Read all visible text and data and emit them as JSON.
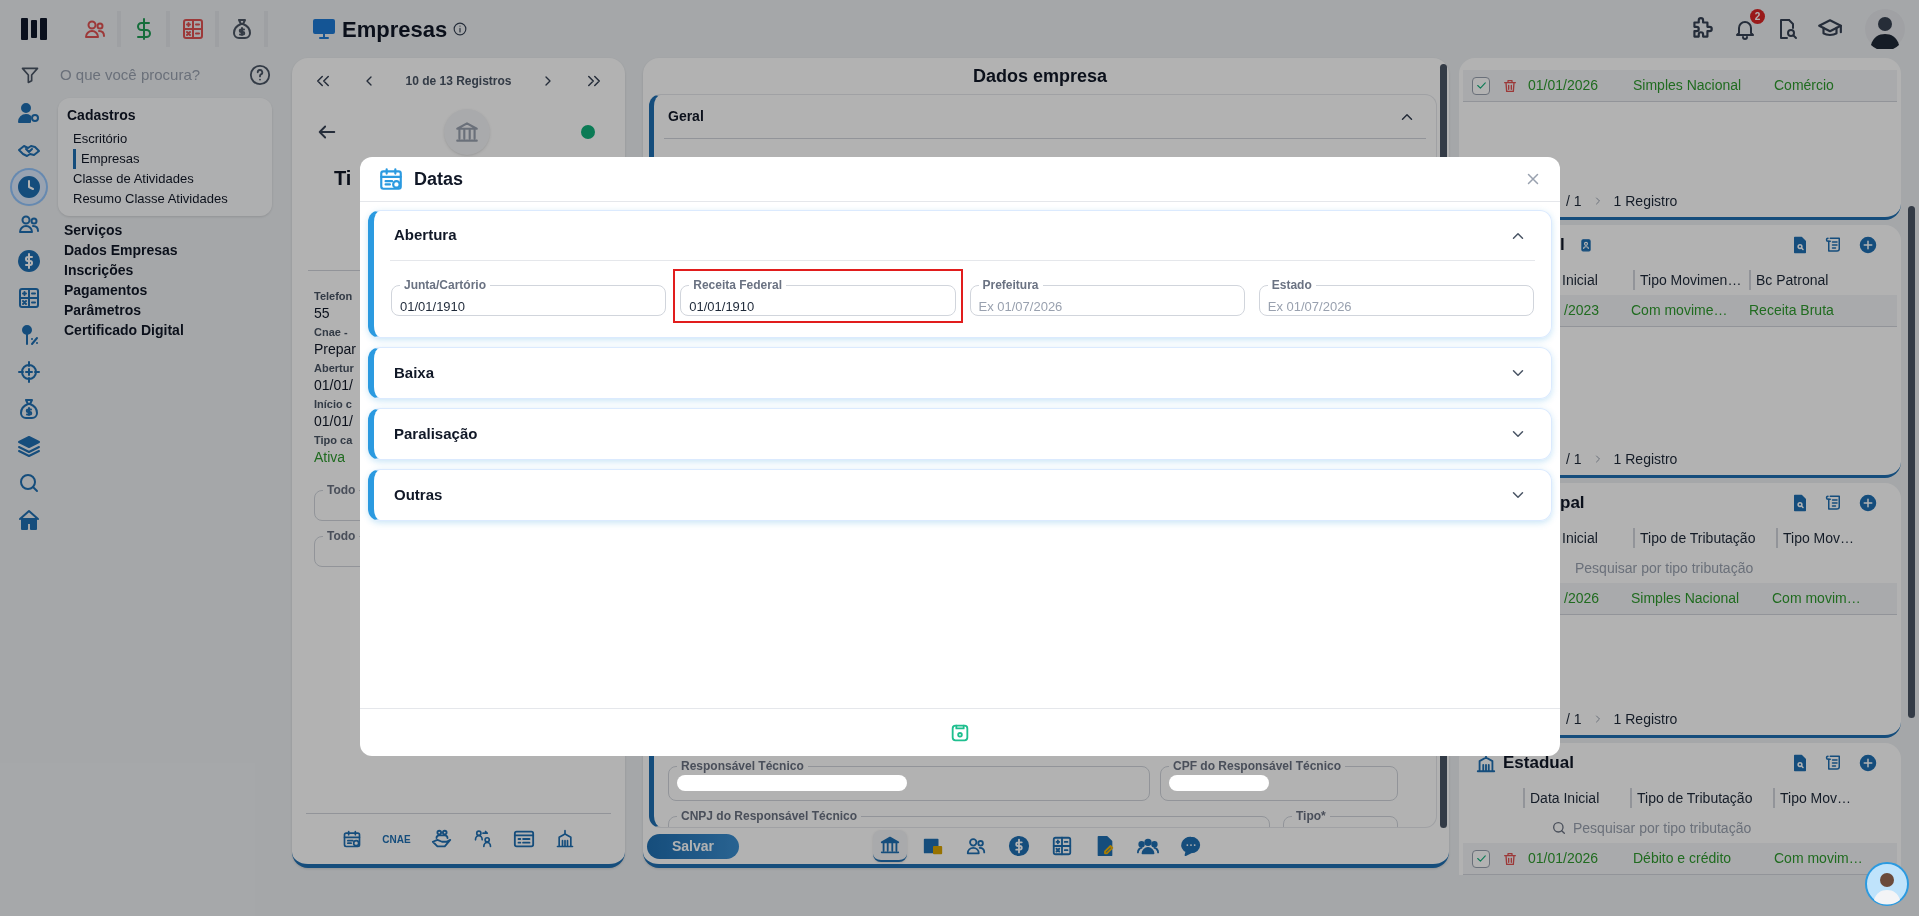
{
  "header": {
    "title": "Empresas",
    "notifications": "2"
  },
  "search": {
    "placeholder": "O que você procura?"
  },
  "rail": [
    {
      "selected": false
    },
    {
      "selected": false
    },
    {
      "selected": true
    },
    {
      "selected": false
    },
    {
      "selected": false
    },
    {
      "selected": false
    },
    {
      "selected": false
    },
    {
      "selected": false
    },
    {
      "selected": false
    },
    {
      "selected": false
    },
    {
      "selected": false
    },
    {
      "selected": false
    }
  ],
  "menu": {
    "group": "Cadastros",
    "items": [
      {
        "label": "Escritório",
        "selected": false
      },
      {
        "label": "Empresas",
        "selected": true
      },
      {
        "label": "Classe de Atividades",
        "selected": false
      },
      {
        "label": "Resumo Classe Atividades",
        "selected": false
      }
    ],
    "sections": [
      "Serviços",
      "Dados Empresas",
      "Inscrições",
      "Pagamentos",
      "Parâmetros",
      "Certificado Digital"
    ]
  },
  "record_panel": {
    "pager": "10 de 13 Registros",
    "title": "Ti",
    "fields": [
      {
        "label": "Telefon",
        "value": "55",
        "kind": "plain"
      },
      {
        "label": "Cnae -",
        "value": "Prepar",
        "kind": "plain"
      },
      {
        "label": "Abertur",
        "value": "01/01/",
        "kind": "plain"
      },
      {
        "label": "Início c",
        "value": "01/01/",
        "kind": "plain"
      },
      {
        "label": "Tipo ca",
        "value": "Ativa",
        "kind": "status"
      }
    ],
    "filters": [
      "Todo",
      "Todo"
    ],
    "icon_bar_label": "CNAE"
  },
  "company": {
    "title": "Dados empresa",
    "section": {
      "title": "Geral",
      "expanded": true
    },
    "fields": [
      {
        "label": "Responsável Técnico",
        "redacted": true
      },
      {
        "label": "CPF do Responsável Técnico",
        "redacted": true
      },
      {
        "label": "CNPJ do Responsável Técnico",
        "redacted": false
      },
      {
        "label": "Tipo*",
        "redacted": false
      }
    ],
    "save": "Salvar",
    "tabs": [
      {
        "selected": true
      },
      {
        "selected": false
      },
      {
        "selected": false
      },
      {
        "selected": false
      },
      {
        "selected": false
      },
      {
        "selected": false
      },
      {
        "selected": false
      },
      {
        "selected": false
      }
    ]
  },
  "right_cards": [
    {
      "rows": [
        {
          "checked": true,
          "cells": [
            "01/01/2026",
            "Simples Nacional",
            "Comércio"
          ]
        }
      ],
      "footer": {
        "pages": "/ 1",
        "records": "1 Registro"
      }
    },
    {
      "title": "l",
      "actions": true,
      "columns": [
        "Inicial",
        "Tipo Movimen…",
        "Bc Patronal"
      ],
      "rows": [
        {
          "cells": [
            "/2023",
            "Com movime…",
            "Receita Bruta"
          ]
        }
      ],
      "footer": {
        "pages": "/ 1",
        "records": "1 Registro"
      }
    },
    {
      "title": "pal",
      "actions": true,
      "columns": [
        "Inicial",
        "Tipo de Tributação",
        "Tipo Mov…"
      ],
      "placeholder": "Pesquisar por tipo tributação",
      "rows": [
        {
          "cells": [
            "/2026",
            "Simples Nacional",
            "Com movim…"
          ]
        }
      ],
      "footer": {
        "pages": "/ 1",
        "records": "1 Registro"
      }
    },
    {
      "title": "Estadual",
      "actions": true,
      "columns": [
        "Data Inicial",
        "Tipo de Tributação",
        "Tipo Mov…"
      ],
      "placeholder": "Pesquisar por tipo tributação",
      "rows": [
        {
          "checked": true,
          "cells": [
            "01/01/2026",
            "Débito e crédito",
            "Com movim…"
          ]
        }
      ]
    }
  ],
  "modal": {
    "title": "Datas",
    "sections": [
      {
        "title": "Abertura",
        "expanded": true,
        "fields": [
          {
            "label": "Junta/Cartório",
            "value": "01/01/1910",
            "highlighted": false
          },
          {
            "label": "Receita Federal",
            "value": "01/01/1910",
            "highlighted": true
          },
          {
            "label": "Prefeitura",
            "placeholder": "Ex 01/07/2026",
            "highlighted": false
          },
          {
            "label": "Estado",
            "placeholder": "Ex 01/07/2026",
            "highlighted": false
          }
        ]
      },
      {
        "title": "Baixa",
        "expanded": false
      },
      {
        "title": "Paralisação",
        "expanded": false
      },
      {
        "title": "Outras",
        "expanded": false
      }
    ]
  }
}
